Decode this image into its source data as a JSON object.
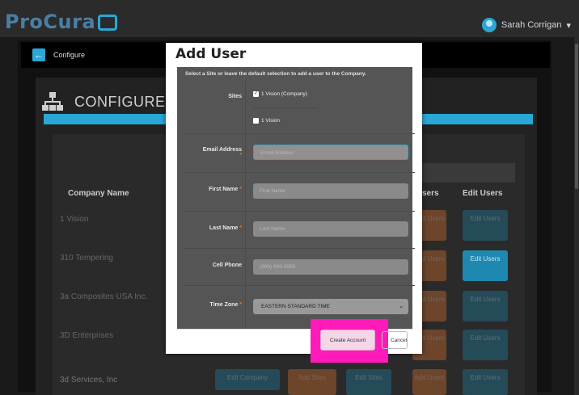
{
  "app": {
    "logo_text": "ProCura",
    "user_name": "Sarah Corrigan",
    "user_caret": "▾"
  },
  "nav": {
    "back_icon": "arrow-left-icon",
    "configure_label": "Configure"
  },
  "page": {
    "title": "CONFIGURE",
    "title_icon": "org-chart-icon"
  },
  "table": {
    "headers": [
      "Company Name",
      "sers",
      "Edit Users"
    ],
    "rows": [
      {
        "name": "1 Vision",
        "add_users": "Add Users",
        "edit_users": "Edit Users"
      },
      {
        "name": "310 Tempering",
        "add_users": "Add Users",
        "edit_users": "Edit Users"
      },
      {
        "name": "3a Composites USA Inc.",
        "add_users": "Add Users",
        "edit_users": "Edit Users"
      },
      {
        "name": "3D Enterprises",
        "add_users": "Add Users",
        "edit_users": "Edit Users"
      },
      {
        "name": "3d Services, Inc",
        "edit_company": "Edit Company",
        "add_sites": "Add Sites",
        "edit_sites": "Edit Sites",
        "add_users": "Add Users",
        "edit_users": "Edit Users"
      }
    ]
  },
  "modal": {
    "title": "Add User",
    "intro": "Select a Site or leave the default selection to add a user to the Company.",
    "sites_label": "Sites",
    "sites": [
      {
        "label": "1 Vision (Company)",
        "checked": true
      },
      {
        "label": "1 Vision",
        "checked": false
      }
    ],
    "fields": {
      "email": {
        "label": "Email Address",
        "placeholder": "Email Address",
        "required": true
      },
      "first_name": {
        "label": "First Name",
        "placeholder": "First Name",
        "required": true
      },
      "last_name": {
        "label": "Last Name",
        "placeholder": "Last Name",
        "required": true
      },
      "cell_phone": {
        "label": "Cell Phone",
        "placeholder": "(999) 999-9999",
        "required": false
      },
      "time_zone": {
        "label": "Time Zone",
        "value": "EASTERN STANDARD TIME",
        "required": true
      }
    },
    "required_mark": "*",
    "create_label": "Create Account",
    "cancel_label": "Cancel"
  },
  "colors": {
    "accent": "#2aa7d6",
    "orange": "#e8772e",
    "highlight": "#ff1aba"
  }
}
